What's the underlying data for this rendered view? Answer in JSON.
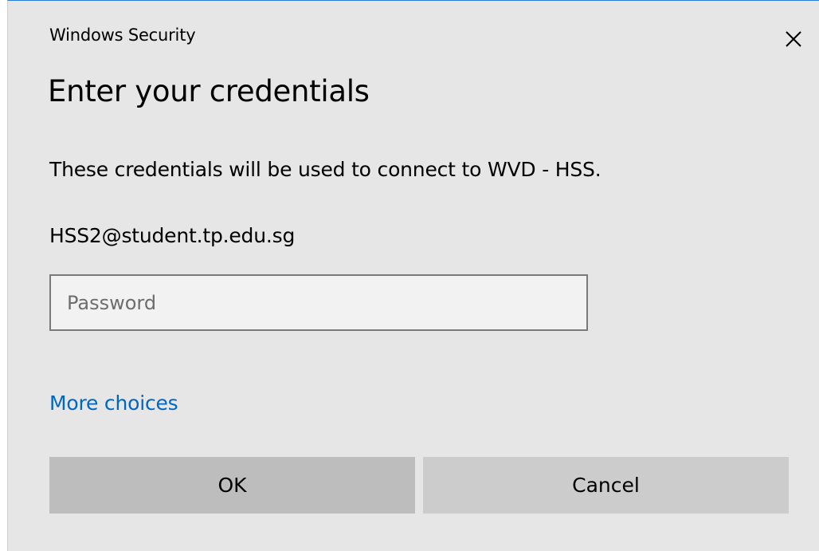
{
  "window": {
    "title": "Windows Security",
    "close_label": "✕"
  },
  "heading": "Enter your credentials",
  "description": "These credentials will be used to connect to WVD - HSS.",
  "username": "HSS2@student.tp.edu.sg",
  "password": {
    "placeholder": "Password",
    "value": ""
  },
  "more_choices": "More choices",
  "buttons": {
    "ok": "OK",
    "cancel": "Cancel"
  },
  "colors": {
    "dialog_background": "#e6e6e6",
    "link": "#0067c0",
    "accent_border": "#2b7cd3",
    "button": "#cccccc"
  },
  "icons": {
    "close": "close-icon"
  }
}
